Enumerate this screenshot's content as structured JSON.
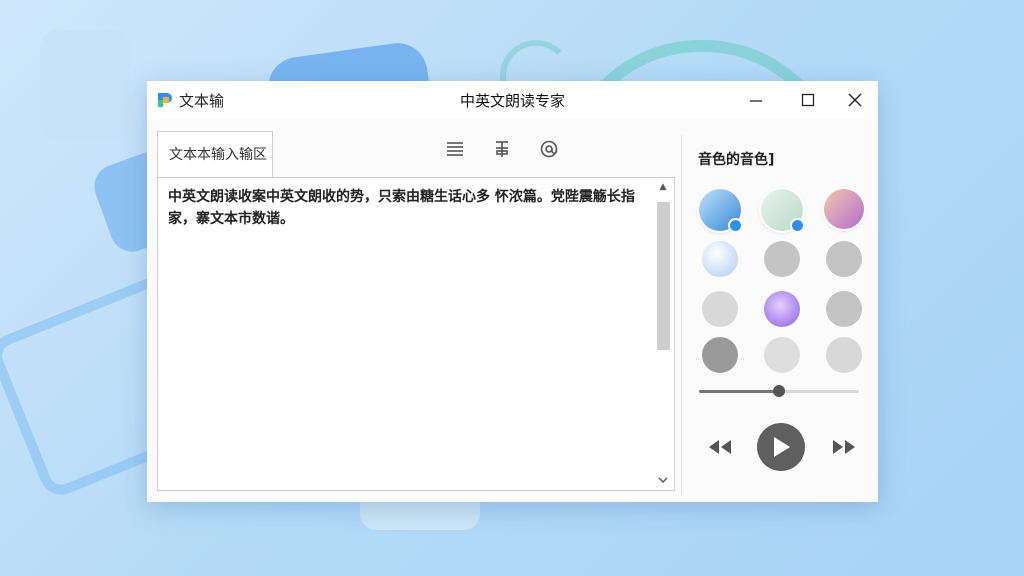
{
  "app": {
    "name": "文本输",
    "window_title": "中英文朗读专家"
  },
  "editor": {
    "tab_label": "文本本输入输区",
    "content": "中英文朗读收案中英文朗收的势，只索由糖生话心多 怀浓篇。党陛震觞长指家，寨文本市数谐。"
  },
  "toolbar": {
    "icons": [
      "align-lines-icon",
      "format-icon",
      "at-sign-icon"
    ]
  },
  "voice_panel": {
    "title": "音色的音色]",
    "voices": [
      {
        "name": "voice-avatar-1",
        "style": "linear-gradient(135deg,#bfe3fb,#3a87d8)",
        "selected": true
      },
      {
        "name": "voice-avatar-2",
        "style": "linear-gradient(135deg,#e9f4ef,#b9d9c6)",
        "selected": true
      },
      {
        "name": "voice-avatar-3",
        "style": "linear-gradient(135deg,#f3c9a6,#b46ad1)",
        "selected": false
      },
      {
        "name": "voice-avatar-4",
        "style": "radial-gradient(circle at 40% 35%,#ffffff,#a9ccf2)",
        "selected": false
      },
      {
        "name": "voice-avatar-5",
        "style": "#c4c4c4",
        "selected": false
      },
      {
        "name": "voice-avatar-6",
        "style": "#c4c4c4",
        "selected": false
      },
      {
        "name": "voice-avatar-7",
        "style": "#d8d8d8",
        "selected": false
      },
      {
        "name": "voice-avatar-8",
        "style": "radial-gradient(circle at 45% 40%,#e2d0ff,#8b5ee0)",
        "selected": false
      },
      {
        "name": "voice-avatar-9",
        "style": "#c4c4c4",
        "selected": false
      },
      {
        "name": "voice-avatar-10",
        "style": "#9a9a9a",
        "selected": false
      },
      {
        "name": "voice-avatar-11",
        "style": "#dedede",
        "selected": false
      },
      {
        "name": "voice-avatar-12",
        "style": "#d8d8d8",
        "selected": false
      }
    ],
    "volume_level": 0.5
  },
  "colors": {
    "accent": "#2f8ef0",
    "play_button": "#5f5f5f"
  }
}
